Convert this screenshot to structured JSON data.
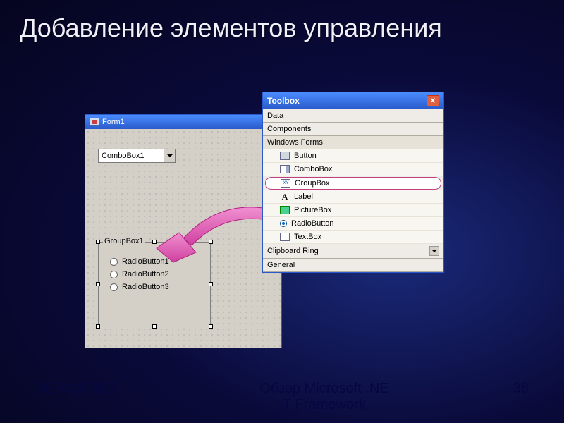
{
  "slide": {
    "title": "Добавление элементов управления"
  },
  "form": {
    "title": "Form1",
    "combo_value": "ComboBox1",
    "groupbox_label": "GroupBox1",
    "radios": [
      "RadioButton1",
      "RadioButton2",
      "RadioButton3"
    ]
  },
  "toolbox": {
    "title": "Toolbox",
    "sections_top": [
      "Data",
      "Components",
      "Windows Forms"
    ],
    "items": [
      {
        "label": "Button",
        "icon": "ic-btn"
      },
      {
        "label": "ComboBox",
        "icon": "ic-combo"
      },
      {
        "label": "GroupBox",
        "icon": "ic-gb",
        "selected": true
      },
      {
        "label": "Label",
        "icon": "ic-lbl",
        "icon_text": "A"
      },
      {
        "label": "PictureBox",
        "icon": "ic-pic"
      },
      {
        "label": "RadioButton",
        "icon": "ic-radio"
      },
      {
        "label": "TextBox",
        "icon": "ic-tb"
      }
    ],
    "sections_bottom": [
      "Clipboard Ring",
      "General"
    ]
  },
  "footer": {
    "left": "SE MSF.NET",
    "mid_line1": "Обзор Microsoft .NE",
    "mid_line2": "T Framework",
    "page": "38"
  }
}
